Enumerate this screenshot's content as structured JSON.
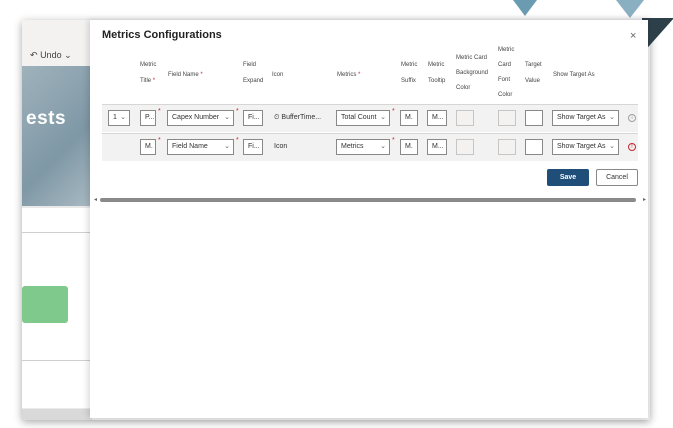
{
  "background": {
    "undo_label": "Undo",
    "hero_text": "ests"
  },
  "dialog": {
    "title": "Metrics Configurations",
    "close_glyph": "×"
  },
  "columns": {
    "metric_title": [
      "Metric",
      "Title"
    ],
    "field_name": "Field Name",
    "field_expand": [
      "Field",
      "Expand"
    ],
    "icon": "Icon",
    "metrics": "Metrics",
    "metric_suffix": [
      "Metric",
      "Suffix"
    ],
    "metric_tooltip": [
      "Metric",
      "Tooltip"
    ],
    "card_bg_color": [
      "Metric Card",
      "Background",
      "Color"
    ],
    "card_font_color": [
      "Metric",
      "Card",
      "Font",
      "Color"
    ],
    "target_value": [
      "Target",
      "Value"
    ],
    "show_target_as": "Show Target As"
  },
  "rows": [
    {
      "index": "1",
      "metric_title": "P...",
      "field_name": "Capex Number",
      "field_expand": "Fi...",
      "icon": "BufferTime...",
      "metrics": "Total Count",
      "metric_suffix": "M.",
      "metric_tooltip": "M...",
      "show_target_as": "Show Target As",
      "status_icon": "info-icon",
      "status_color": "#a19f9d"
    },
    {
      "metric_title": "M.",
      "field_name": "Field Name",
      "field_expand": "Fi...",
      "icon": "Icon",
      "metrics": "Metrics",
      "metric_suffix": "M.",
      "metric_tooltip": "M...",
      "show_target_as": "Show Target As",
      "status_icon": "error-icon",
      "status_color": "#c4262e"
    }
  ],
  "actions": {
    "save": "Save",
    "cancel": "Cancel"
  },
  "colors": {
    "primary": "#1f4e79",
    "required": "#c4262e"
  }
}
